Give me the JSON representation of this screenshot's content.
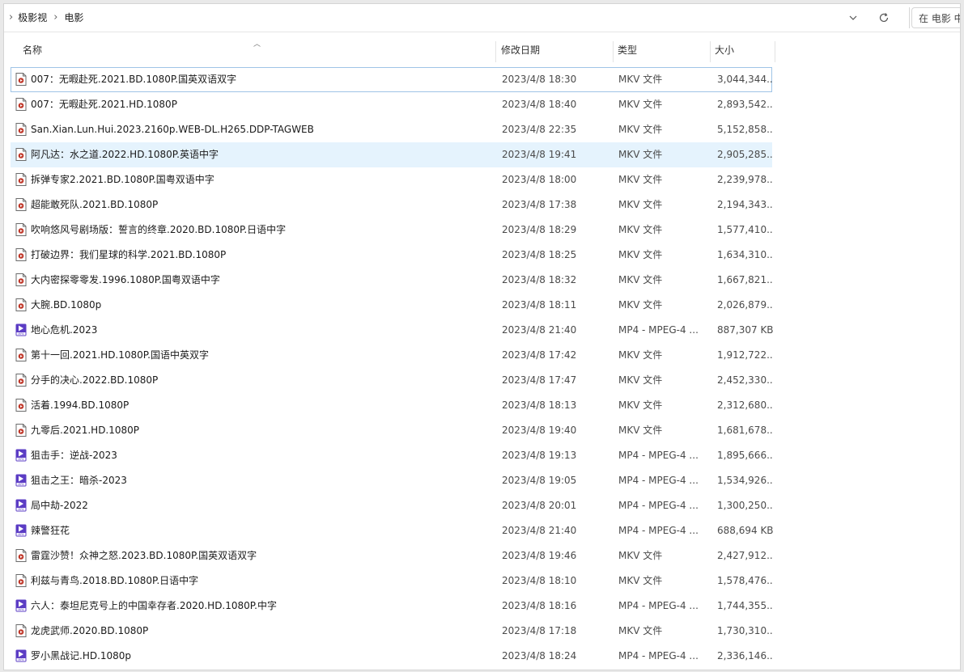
{
  "breadcrumb": {
    "items": [
      "极影视",
      "电影"
    ]
  },
  "search": {
    "placeholder": "在 电影 中"
  },
  "columns": {
    "name": "名称",
    "date": "修改日期",
    "type": "类型",
    "size": "大小"
  },
  "accent": "#9fc4e6",
  "files": [
    {
      "name": "007：无暇赴死.2021.BD.1080P.国英双语双字",
      "date": "2023/4/8 18:30",
      "type": "MKV 文件",
      "size": "3,044,344...",
      "icon": "mkv-video-file-icon"
    },
    {
      "name": "007：无暇赴死.2021.HD.1080P",
      "date": "2023/4/8 18:40",
      "type": "MKV 文件",
      "size": "2,893,542...",
      "icon": "mkv-video-file-icon"
    },
    {
      "name": "San.Xian.Lun.Hui.2023.2160p.WEB-DL.H265.DDP-TAGWEB",
      "date": "2023/4/8 22:35",
      "type": "MKV 文件",
      "size": "5,152,858...",
      "icon": "mkv-video-file-icon"
    },
    {
      "name": "阿凡达：水之道.2022.HD.1080P.英语中字",
      "date": "2023/4/8 19:41",
      "type": "MKV 文件",
      "size": "2,905,285...",
      "icon": "mkv-video-file-icon"
    },
    {
      "name": "拆弹专家2.2021.BD.1080P.国粤双语中字",
      "date": "2023/4/8 18:00",
      "type": "MKV 文件",
      "size": "2,239,978...",
      "icon": "mkv-video-file-icon"
    },
    {
      "name": "超能敢死队.2021.BD.1080P",
      "date": "2023/4/8 17:38",
      "type": "MKV 文件",
      "size": "2,194,343...",
      "icon": "mkv-video-file-icon"
    },
    {
      "name": "吹响悠风号剧场版：誓言的终章.2020.BD.1080P.日语中字",
      "date": "2023/4/8 18:29",
      "type": "MKV 文件",
      "size": "1,577,410...",
      "icon": "mkv-video-file-icon"
    },
    {
      "name": "打破边界：我们星球的科学.2021.BD.1080P",
      "date": "2023/4/8 18:25",
      "type": "MKV 文件",
      "size": "1,634,310...",
      "icon": "mkv-video-file-icon"
    },
    {
      "name": "大内密探零零发.1996.1080P.国粤双语中字",
      "date": "2023/4/8 18:32",
      "type": "MKV 文件",
      "size": "1,667,821...",
      "icon": "mkv-video-file-icon"
    },
    {
      "name": "大腕.BD.1080p",
      "date": "2023/4/8 18:11",
      "type": "MKV 文件",
      "size": "2,026,879...",
      "icon": "mkv-video-file-icon"
    },
    {
      "name": "地心危机.2023",
      "date": "2023/4/8 21:40",
      "type": "MP4 - MPEG-4 ...",
      "size": "887,307 KB",
      "icon": "mp4-video-file-icon"
    },
    {
      "name": "第十一回.2021.HD.1080P.国语中英双字",
      "date": "2023/4/8 17:42",
      "type": "MKV 文件",
      "size": "1,912,722...",
      "icon": "mkv-video-file-icon"
    },
    {
      "name": "分手的决心.2022.BD.1080P",
      "date": "2023/4/8 17:47",
      "type": "MKV 文件",
      "size": "2,452,330...",
      "icon": "mkv-video-file-icon"
    },
    {
      "name": "活着.1994.BD.1080P",
      "date": "2023/4/8 18:13",
      "type": "MKV 文件",
      "size": "2,312,680...",
      "icon": "mkv-video-file-icon"
    },
    {
      "name": "九零后.2021.HD.1080P",
      "date": "2023/4/8 19:40",
      "type": "MKV 文件",
      "size": "1,681,678...",
      "icon": "mkv-video-file-icon"
    },
    {
      "name": "狙击手：逆战-2023",
      "date": "2023/4/8 19:13",
      "type": "MP4 - MPEG-4 ...",
      "size": "1,895,666...",
      "icon": "mp4-video-file-icon"
    },
    {
      "name": "狙击之王：暗杀-2023",
      "date": "2023/4/8 19:05",
      "type": "MP4 - MPEG-4 ...",
      "size": "1,534,926...",
      "icon": "mp4-video-file-icon"
    },
    {
      "name": "局中劫-2022",
      "date": "2023/4/8 20:01",
      "type": "MP4 - MPEG-4 ...",
      "size": "1,300,250...",
      "icon": "mp4-video-file-icon"
    },
    {
      "name": "辣警狂花",
      "date": "2023/4/8 21:40",
      "type": "MP4 - MPEG-4 ...",
      "size": "688,694 KB",
      "icon": "mp4-video-file-icon"
    },
    {
      "name": "雷霆沙赞！众神之怒.2023.BD.1080P.国英双语双字",
      "date": "2023/4/8 19:46",
      "type": "MKV 文件",
      "size": "2,427,912...",
      "icon": "mkv-video-file-icon"
    },
    {
      "name": "利兹与青鸟.2018.BD.1080P.日语中字",
      "date": "2023/4/8 18:10",
      "type": "MKV 文件",
      "size": "1,578,476...",
      "icon": "mkv-video-file-icon"
    },
    {
      "name": "六人：泰坦尼克号上的中国幸存者.2020.HD.1080P.中字",
      "date": "2023/4/8 18:16",
      "type": "MP4 - MPEG-4 ...",
      "size": "1,744,355...",
      "icon": "mp4-video-file-icon"
    },
    {
      "name": "龙虎武师.2020.BD.1080P",
      "date": "2023/4/8 17:18",
      "type": "MKV 文件",
      "size": "1,730,310...",
      "icon": "mkv-video-file-icon"
    },
    {
      "name": "罗小黑战记.HD.1080p",
      "date": "2023/4/8 18:24",
      "type": "MP4 - MPEG-4 ...",
      "size": "2,336,146...",
      "icon": "mp4-video-file-icon"
    }
  ]
}
